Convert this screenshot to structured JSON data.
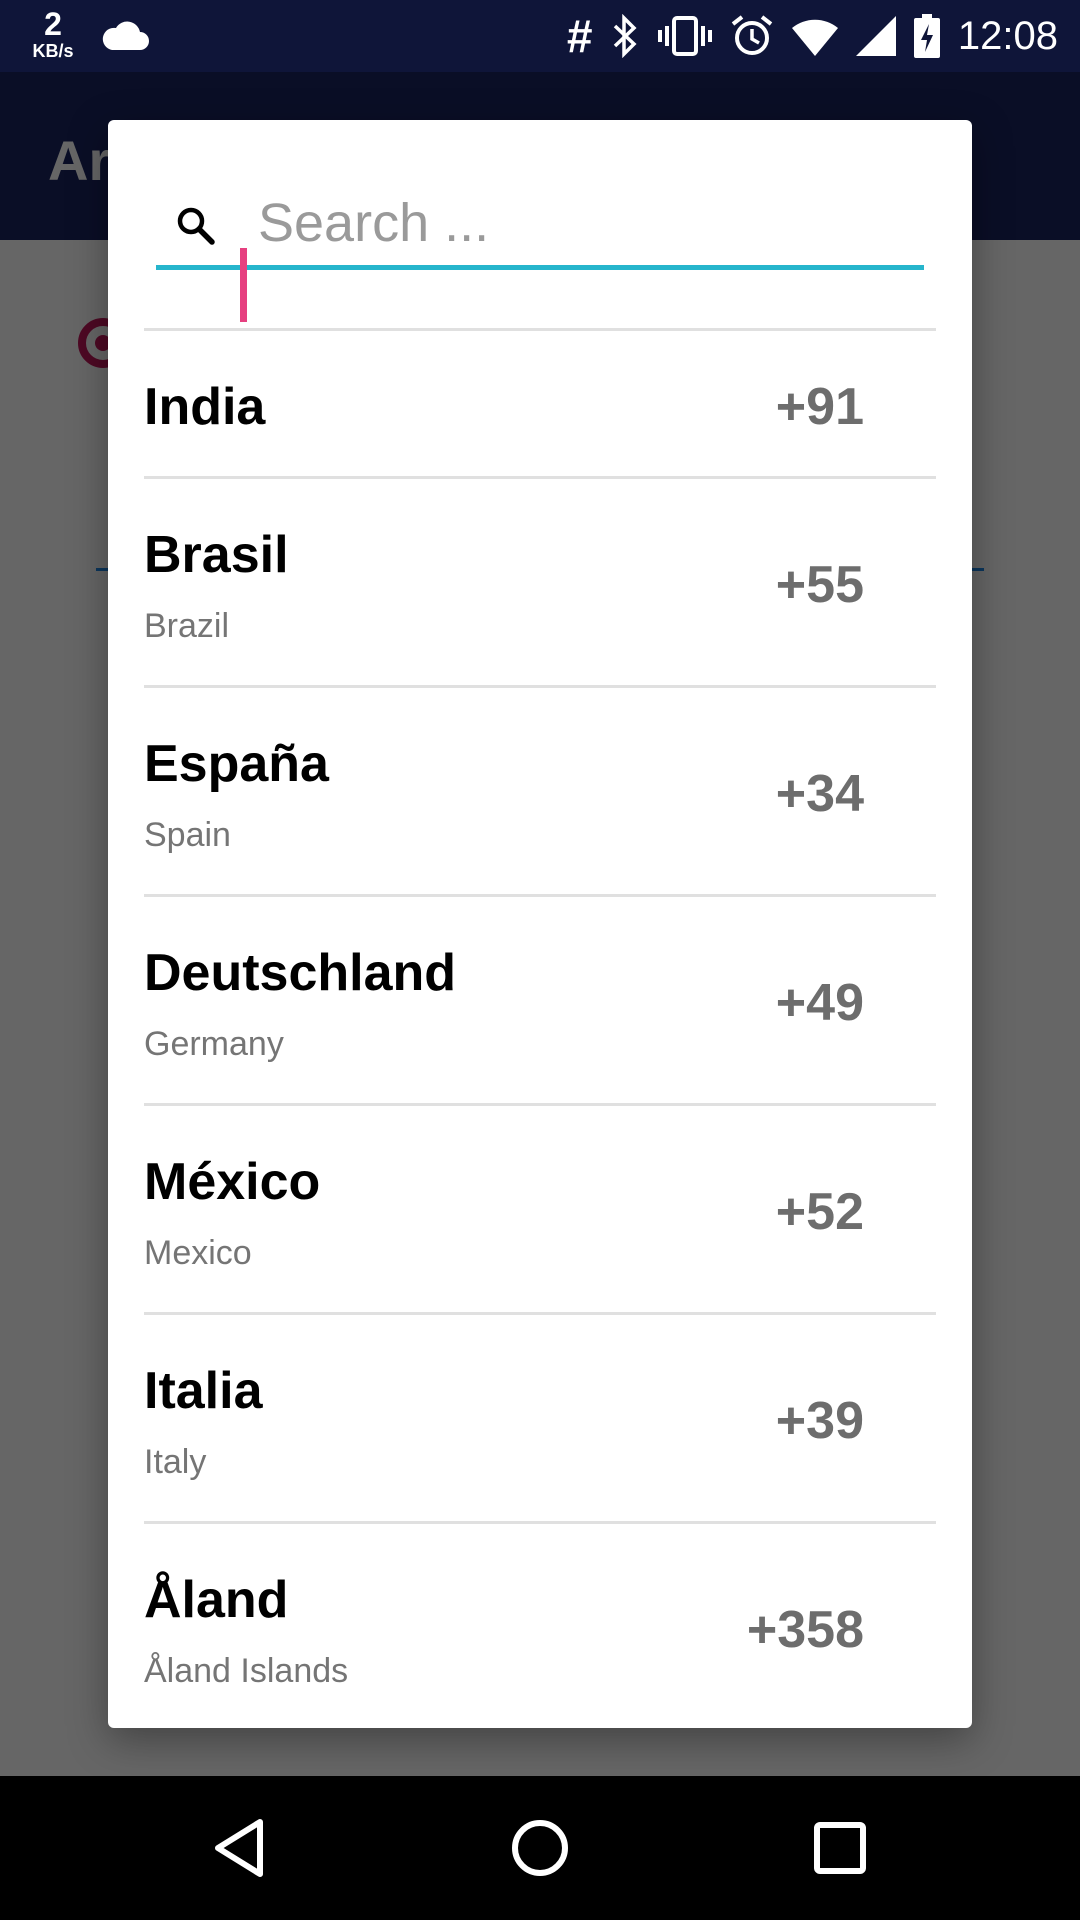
{
  "status_bar": {
    "net_speed_value": "2",
    "net_speed_unit": "KB/s",
    "time": "12:08",
    "icons": [
      "cloud-icon",
      "hash-icon",
      "bluetooth-icon",
      "vibrate-icon",
      "alarm-icon",
      "wifi-icon",
      "signal-icon",
      "battery-charging-icon"
    ]
  },
  "app_bar": {
    "title_fragment": "Ar"
  },
  "dialog": {
    "search": {
      "placeholder": "Search ...",
      "value": ""
    },
    "countries": [
      {
        "name": "India",
        "english": "",
        "code": "+91"
      },
      {
        "name": "Brasil",
        "english": "Brazil",
        "code": "+55"
      },
      {
        "name": "España",
        "english": "Spain",
        "code": "+34"
      },
      {
        "name": "Deutschland",
        "english": "Germany",
        "code": "+49"
      },
      {
        "name": "México",
        "english": "Mexico",
        "code": "+52"
      },
      {
        "name": "Italia",
        "english": "Italy",
        "code": "+39"
      },
      {
        "name": "Åland",
        "english": "Åland Islands",
        "code": "+358"
      }
    ]
  },
  "nav_bar": {
    "buttons": [
      "back-icon",
      "home-icon",
      "recents-icon"
    ]
  },
  "colors": {
    "status_bar": "#0f1539",
    "app_bar": "#1a2360",
    "search_underline": "#26b5cc",
    "cursor": "#e64080",
    "code_text": "#6d6d6d",
    "secondary_text": "#757575"
  }
}
